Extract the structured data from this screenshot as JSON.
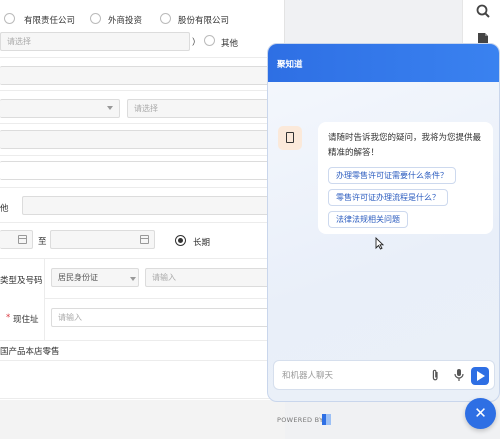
{
  "form": {
    "company_types": [
      "有限责任公司",
      "外商投资",
      "股份有限公司"
    ],
    "select_placeholder": "请选择",
    "bracket_close": "）",
    "other_label": "其他",
    "select_placeholder_2": "请选择",
    "other_label_2": "他",
    "date_to": "至",
    "long_term_label": "长期",
    "id_type_label": "类型及号码",
    "id_type_value": "居民身份证",
    "id_number_placeholder": "请输入",
    "required_mark": "*",
    "address_label": "现住址",
    "address_placeholder": "请输入",
    "product_line": "国产品本店零售"
  },
  "chat": {
    "title": "聚知道",
    "greeting": "请随时告诉我您的疑问，我将为您提供最精准的解答！",
    "suggestions": [
      "办理零售许可证需要什么条件？",
      "零售许可证办理流程是什么？",
      "法律法规相关问题"
    ],
    "input_placeholder": "和机器人聊天",
    "powered_by": "POWERED BY",
    "icons": {
      "attach": "paperclip-icon",
      "mic": "microphone-icon",
      "send": "send-icon",
      "close": "close-icon"
    }
  },
  "toolbar": {
    "icons": [
      "search-icon",
      "document-icon"
    ]
  },
  "colors": {
    "accent": "#2e6fe4",
    "required": "#d9363e"
  }
}
